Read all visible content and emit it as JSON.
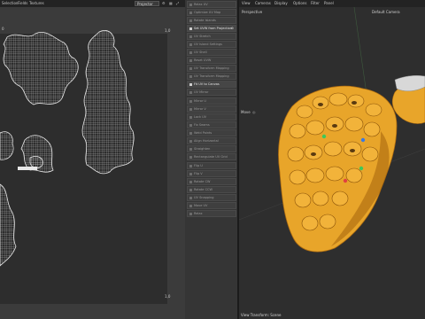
{
  "uv_editor": {
    "menu": [
      "Selection",
      "Fields",
      "Textures"
    ],
    "projection_select": "Projector",
    "tile_label_left": "0",
    "tile_label_top": "1,0",
    "tile_label_bottom": "1,0"
  },
  "tool_panel": {
    "buttons": [
      {
        "label": "Relax UV",
        "active": false
      },
      {
        "label": "Optimize UV Map",
        "active": false
      },
      {
        "label": "Rotate Islands",
        "active": false
      },
      {
        "label": "Set UVW from Projection",
        "active": true
      },
      {
        "label": "UV Stretch",
        "active": false
      },
      {
        "label": "UV Island Settings",
        "active": false
      },
      {
        "label": "UV Shell",
        "active": false
      },
      {
        "label": "Reset UVW",
        "active": false
      },
      {
        "label": "UV Transform Mapping",
        "active": false
      },
      {
        "label": "UV Transform Mapping",
        "active": false
      },
      {
        "label": "UV Packing",
        "active": false
      },
      {
        "label": "Fit UV to Canvas",
        "active": true
      },
      {
        "label": "UV Mirror",
        "active": false
      },
      {
        "label": "Mirror U",
        "active": false
      },
      {
        "label": "Mirror V",
        "active": false
      },
      {
        "label": "Lock UV",
        "active": false
      },
      {
        "label": "Fix Seams",
        "active": false
      },
      {
        "label": "Weld Points",
        "active": false
      },
      {
        "label": "Align Horizontal",
        "active": false
      },
      {
        "label": "Straighten",
        "active": false
      },
      {
        "label": "Rectangulate UV Grid",
        "active": false
      },
      {
        "label": "Rectangulate Island",
        "active": false
      },
      {
        "label": "Flip U",
        "active": false
      },
      {
        "label": "Flip V",
        "active": false
      },
      {
        "label": "Rotate CW",
        "active": false
      },
      {
        "label": "Rotate CCW",
        "active": false
      },
      {
        "label": "Scale Up",
        "active": false
      },
      {
        "label": "UV Snapping",
        "active": false
      },
      {
        "label": "Move UV",
        "active": false
      },
      {
        "label": "Scale UV",
        "active": false
      },
      {
        "label": "Rotate UV",
        "active": false
      },
      {
        "label": "Relax",
        "active": false
      }
    ]
  },
  "viewport": {
    "menu": [
      "View",
      "Cameras",
      "Display",
      "Options",
      "Filter",
      "Panel"
    ],
    "view_name": "Perspective",
    "camera_name": "Default Camera",
    "move_label": "Move",
    "status": "View Transform: Scene",
    "colors": {
      "mesh": "#e8a52a",
      "mesh_shadow": "#9a6410",
      "handle_green": "#3cc85a",
      "handle_blue": "#3c7ae0",
      "handle_red": "#e04040"
    }
  }
}
